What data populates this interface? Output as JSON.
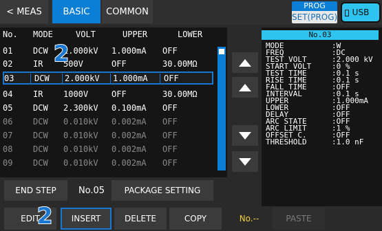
{
  "tabs": {
    "meas": "< MEAS",
    "basic": "BASIC",
    "common": "COMMON"
  },
  "status": {
    "prog_top": "PROG",
    "prog_bottom": "SET(PROG)",
    "usb": "USB"
  },
  "table": {
    "headers": [
      "No.",
      "MODE",
      "VOLT",
      "UPPER",
      "LOWER"
    ],
    "rows": [
      {
        "no": "01",
        "mode": "DCW",
        "volt": "1.000kV",
        "upper": "1.000mA",
        "lower": "OFF"
      },
      {
        "no": "02",
        "mode": "IR",
        "volt": "500V",
        "upper": "OFF",
        "lower": "30.00MΩ"
      },
      {
        "no": "03",
        "mode": "DCW",
        "volt": "2.000kV",
        "upper": "1.000mA",
        "lower": "OFF"
      },
      {
        "no": "04",
        "mode": "IR",
        "volt": "1000V",
        "upper": "OFF",
        "lower": "30.00MΩ"
      },
      {
        "no": "05",
        "mode": "DCW",
        "volt": "2.300kV",
        "upper": "0.100mA",
        "lower": "OFF"
      },
      {
        "no": "06",
        "mode": "DCW",
        "volt": "0.010kV",
        "upper": "0.002mA",
        "lower": "OFF"
      },
      {
        "no": "07",
        "mode": "DCW",
        "volt": "0.010kV",
        "upper": "0.002mA",
        "lower": "OFF"
      },
      {
        "no": "08",
        "mode": "DCW",
        "volt": "0.010kV",
        "upper": "0.002mA",
        "lower": "OFF"
      },
      {
        "no": "09",
        "mode": "DCW",
        "volt": "0.010kV",
        "upper": "0.002mA",
        "lower": "OFF"
      }
    ]
  },
  "detail": {
    "title": "No.03",
    "items": [
      {
        "k": "MODE",
        "v": ":W"
      },
      {
        "k": "FREQ",
        "v": ":DC"
      },
      {
        "k": "TEST VOLT",
        "v": ":2.000 kV"
      },
      {
        "k": "START VOLT",
        "v": ":0 %"
      },
      {
        "k": "TEST TIME",
        "v": ":0.1 s"
      },
      {
        "k": "RISE TIME",
        "v": ":0.1 s"
      },
      {
        "k": "FALL TIME",
        "v": ":OFF"
      },
      {
        "k": "INTERVAL",
        "v": ":0.1 s"
      },
      {
        "k": "UPPER",
        "v": ":1.000mA"
      },
      {
        "k": "LOWER",
        "v": ":OFF"
      },
      {
        "k": "DELAY",
        "v": ":OFF"
      },
      {
        "k": "ARC STATE",
        "v": ":OFF"
      },
      {
        "k": "ARC LIMIT",
        "v": ":1 %"
      },
      {
        "k": "OFFSET C.",
        "v": ":OFF"
      },
      {
        "k": "THRESHOLD",
        "v": ":1.0 nF"
      }
    ]
  },
  "end_step": {
    "label": "END STEP",
    "value": "No.05"
  },
  "package_setting": "PACKAGE SETTING",
  "toolbar": {
    "edit": "EDIT",
    "insert": "INSERT",
    "delete": "DELETE",
    "copy": "COPY",
    "no_field": "No.--",
    "paste": "PASTE"
  },
  "callouts": [
    "2",
    "2"
  ],
  "colors": {
    "accent": "#0b7fd6",
    "selection": "#1a78d2",
    "detail_title": "#2ec4ef",
    "no_field": "#f0d040"
  }
}
